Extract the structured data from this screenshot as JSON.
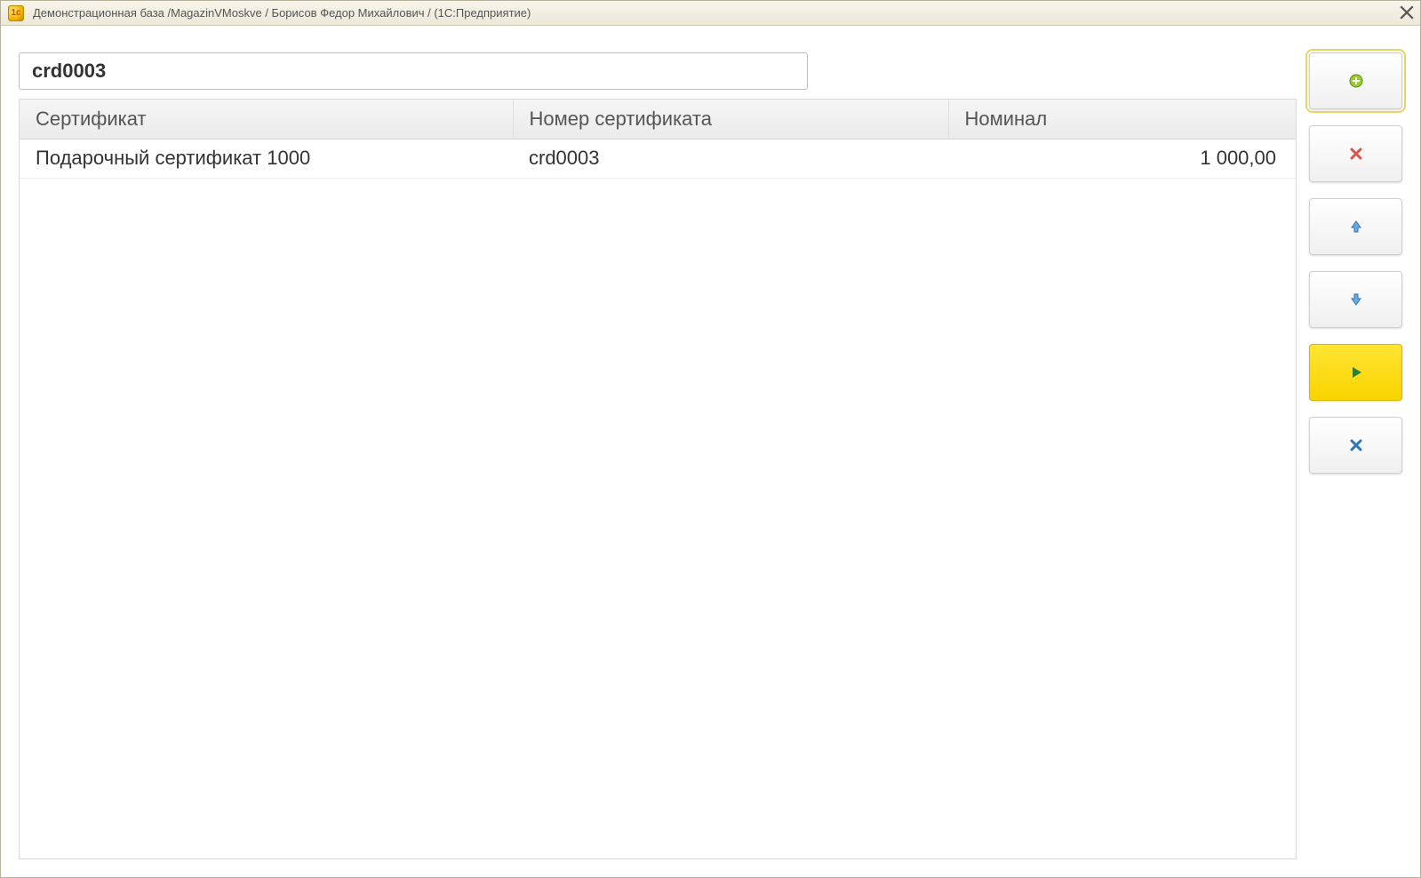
{
  "window": {
    "title": "Демонстрационная база /MagazinVMoskve / Борисов Федор Михайлович /  (1С:Предприятие)",
    "app_icon_text": "1c"
  },
  "search": {
    "value": "crd0003"
  },
  "table": {
    "headers": {
      "certificate": "Сертификат",
      "number": "Номер сертификата",
      "nominal": "Номинал"
    },
    "rows": [
      {
        "certificate": "Подарочный сертификат 1000",
        "number": "crd0003",
        "nominal": "1 000,00"
      }
    ]
  },
  "icons": {
    "add": "plus-circle-icon",
    "remove": "x-red-icon",
    "up": "arrow-up-icon",
    "down": "arrow-down-icon",
    "play": "play-icon",
    "cancel": "x-blue-icon"
  }
}
